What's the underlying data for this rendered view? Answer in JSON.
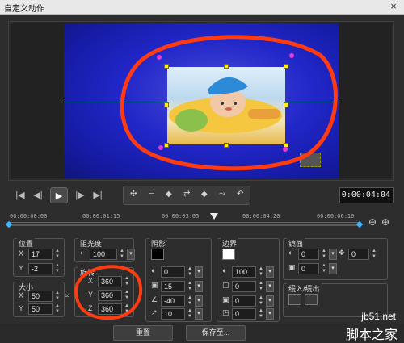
{
  "window": {
    "title": "自定义动作",
    "close": "×"
  },
  "preview": {
    "scene": "baby-photo-clip"
  },
  "transport": {
    "buttons": [
      "|◀",
      "◀|",
      "▶",
      "|▶",
      "▶|"
    ],
    "keyframe_tools": [
      "✣",
      "⊣",
      "◆",
      "⇄",
      "◆",
      "⤳",
      "↶"
    ],
    "timecode": "0:00:04:04"
  },
  "timeline": {
    "ticks": [
      "00:00:00:00",
      "00:00:01:15",
      "00:00:03:05",
      "00:00:04:20",
      "00:00:06:10"
    ]
  },
  "panels": {
    "position": {
      "title": "位置",
      "x_label": "X",
      "x": "17",
      "y_label": "Y",
      "y": "-2"
    },
    "size": {
      "title": "大小",
      "x_label": "X",
      "x": "50",
      "y_label": "Y",
      "y": "50"
    },
    "opacity": {
      "title": "阻光度",
      "value": "100"
    },
    "rotation": {
      "title": "旋转",
      "x_label": "X",
      "x": "360",
      "y_label": "Y",
      "y": "360",
      "z_label": "Z",
      "z": "360"
    },
    "shadow": {
      "title": "阴影",
      "v1": "0",
      "v2": "15",
      "v3": "-40",
      "v4": "10"
    },
    "border": {
      "title": "边界",
      "v1": "100",
      "v2": "0",
      "v3": "0",
      "v4": "0"
    },
    "mirror": {
      "title": "镜面",
      "v1": "0",
      "v2": "0",
      "v3": "0",
      "v4": "0"
    },
    "fade": {
      "title": "缓入/缓出"
    }
  },
  "footer": {
    "reset": "重置",
    "save": "保存至..."
  },
  "watermark": {
    "url": "jb51.net",
    "cn": "脚本之家"
  },
  "colors": {
    "annotation": "#ff3b12",
    "handle": "#ffef16"
  }
}
